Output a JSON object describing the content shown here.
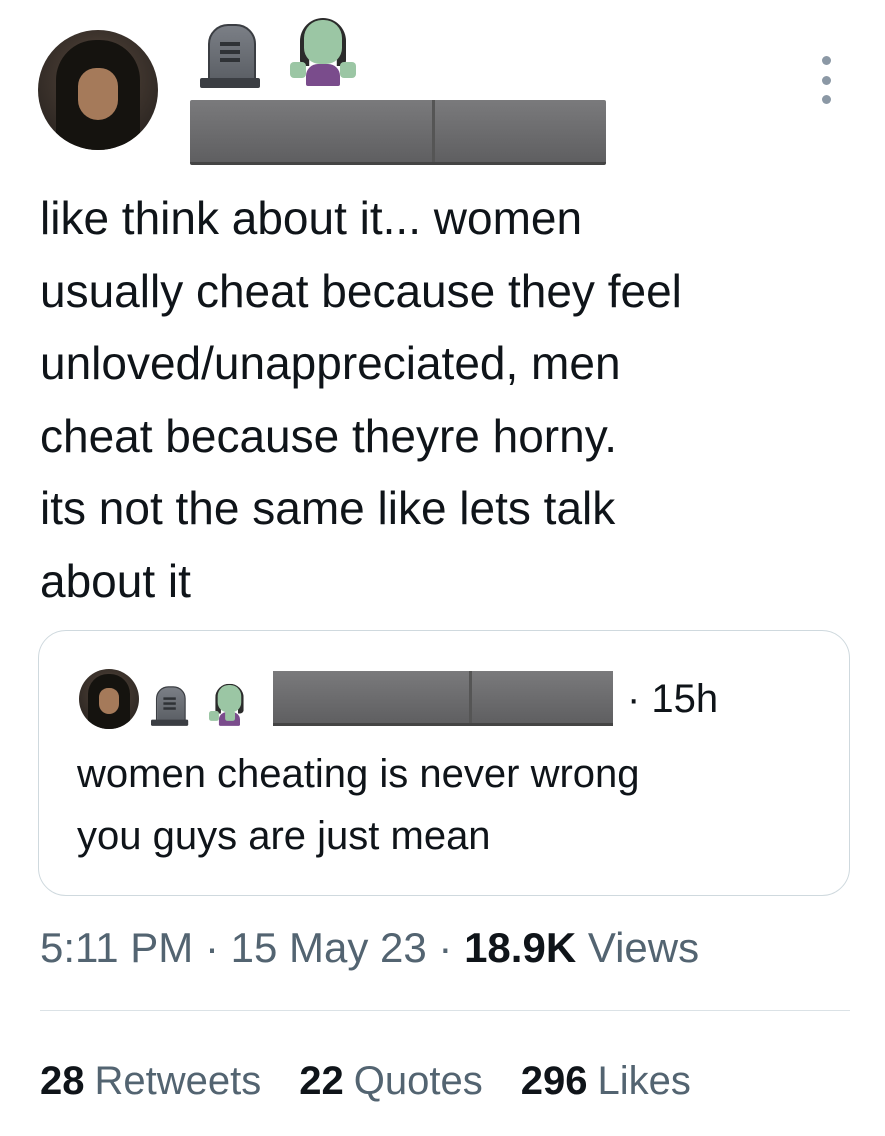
{
  "tweet": {
    "text": "like think about it... women usually cheat because they feel unloved/unappreciated, men cheat because theyre horny. its not the same like lets talk about it",
    "text_lines": [
      "like think about it... women",
      "usually cheat because they feel",
      "unloved/unappreciated, men",
      "cheat because theyre horny.",
      "its not the same like lets talk",
      "about it"
    ],
    "header_icons": [
      "headstone-icon",
      "zombie-icon"
    ],
    "more_icon": "more-options-icon"
  },
  "quote": {
    "time": "· 15h",
    "text_lines": [
      "women cheating is never wrong",
      "you guys are just mean"
    ]
  },
  "meta": {
    "time": "5:11 PM",
    "sep1": " · ",
    "date": "15 May 23",
    "sep2": " · ",
    "views_count": "18.9K",
    "views_label": " Views"
  },
  "stats": {
    "retweets_count": "28",
    "retweets_label": "Retweets",
    "quotes_count": "22",
    "quotes_label": "Quotes",
    "likes_count": "296",
    "likes_label": "Likes"
  }
}
